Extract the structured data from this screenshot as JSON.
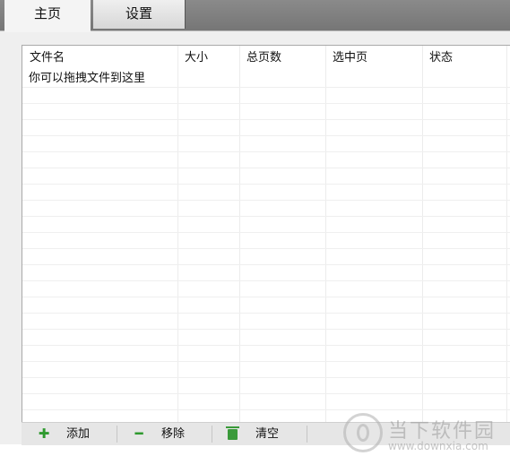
{
  "tabs": [
    {
      "label": "主页",
      "active": true
    },
    {
      "label": "设置",
      "active": false
    }
  ],
  "table": {
    "columns": [
      "文件名",
      "大小",
      "总页数",
      "选中页",
      "状态"
    ],
    "empty_hint": "你可以拖拽文件到这里"
  },
  "toolbar": {
    "add_label": "添加",
    "remove_label": "移除",
    "clear_label": "清空"
  },
  "watermark": {
    "name": "当下软件园",
    "url": "www.downxia.com"
  },
  "icons": {
    "add": "plus-icon",
    "remove": "minus-icon",
    "clear": "trash-icon"
  },
  "colors": {
    "tab_bar": "#7f7f7f",
    "icon_green": "#2f9a2f",
    "panel_bg": "#efefef"
  }
}
